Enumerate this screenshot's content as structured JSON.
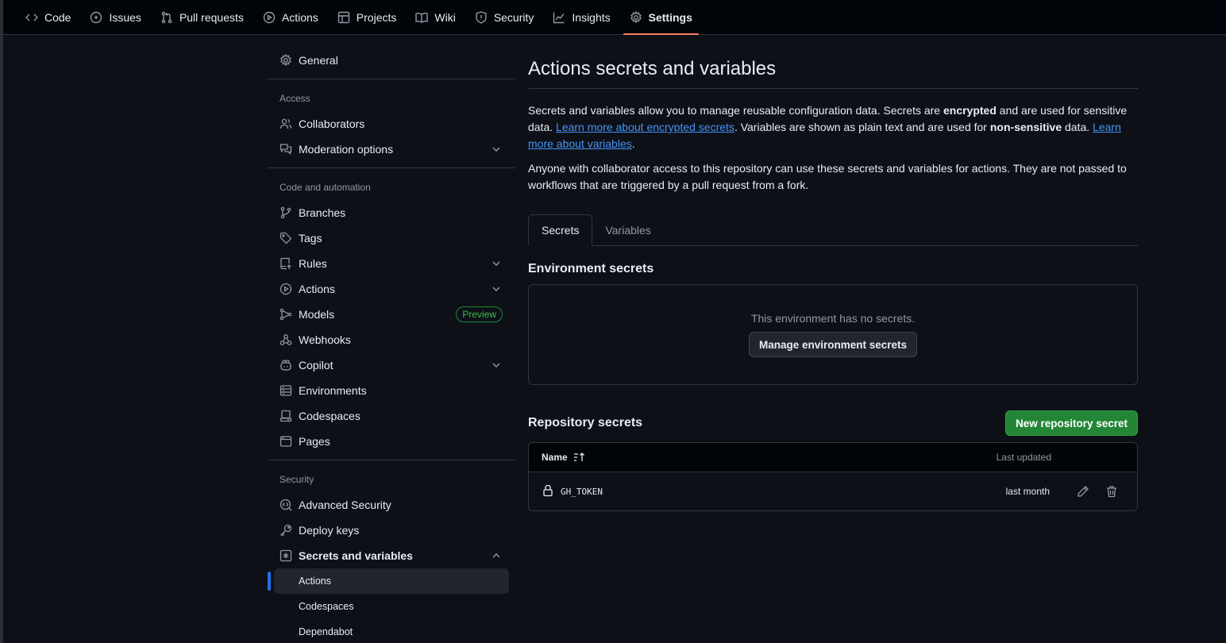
{
  "topnav": {
    "tabs": [
      {
        "label": "Code",
        "icon": "code-icon"
      },
      {
        "label": "Issues",
        "icon": "issue-icon"
      },
      {
        "label": "Pull requests",
        "icon": "pull-request-icon"
      },
      {
        "label": "Actions",
        "icon": "play-icon"
      },
      {
        "label": "Projects",
        "icon": "table-icon"
      },
      {
        "label": "Wiki",
        "icon": "book-icon"
      },
      {
        "label": "Security",
        "icon": "shield-icon"
      },
      {
        "label": "Insights",
        "icon": "graph-icon"
      },
      {
        "label": "Settings",
        "icon": "gear-icon",
        "active": true
      }
    ]
  },
  "sidebar": {
    "general": "General",
    "heading_access": "Access",
    "collaborators": "Collaborators",
    "moderation": "Moderation options",
    "heading_code": "Code and automation",
    "branches": "Branches",
    "tags": "Tags",
    "rules": "Rules",
    "actions": "Actions",
    "models": "Models",
    "models_badge": "Preview",
    "webhooks": "Webhooks",
    "copilot": "Copilot",
    "environments": "Environments",
    "codespaces": "Codespaces",
    "pages": "Pages",
    "heading_security": "Security",
    "advanced_security": "Advanced Security",
    "deploy_keys": "Deploy keys",
    "secrets_variables": "Secrets and variables",
    "sub_actions": "Actions",
    "sub_codespaces": "Codespaces",
    "sub_dependabot": "Dependabot"
  },
  "main": {
    "title": "Actions secrets and variables",
    "desc": {
      "p1_a": "Secrets and variables allow you to manage reusable configuration data. Secrets are ",
      "p1_b": "encrypted",
      "p1_c": " and are used for sensitive data. ",
      "p1_link1": "Learn more about encrypted secrets",
      "p1_d": ". Variables are shown as plain text and are used for ",
      "p1_e": "non-sensitive",
      "p1_f": " data. ",
      "p1_link2": "Learn more about variables",
      "p1_g": ".",
      "p2": "Anyone with collaborator access to this repository can use these secrets and variables for actions. They are not passed to workflows that are triggered by a pull request from a fork."
    },
    "tabs": {
      "secrets": "Secrets",
      "variables": "Variables"
    },
    "env_heading": "Environment secrets",
    "env_empty": "This environment has no secrets.",
    "env_button": "Manage environment secrets",
    "repo_heading": "Repository secrets",
    "new_secret_button": "New repository secret",
    "table": {
      "col_name": "Name",
      "col_updated": "Last updated",
      "rows": [
        {
          "name": "GH_TOKEN",
          "updated": "last month"
        }
      ]
    }
  },
  "colors": {
    "background": "#0d1117",
    "accent_underline": "#f78166",
    "primary_button": "#238636",
    "link": "#4493f8",
    "active_indicator": "#1f6feb"
  }
}
